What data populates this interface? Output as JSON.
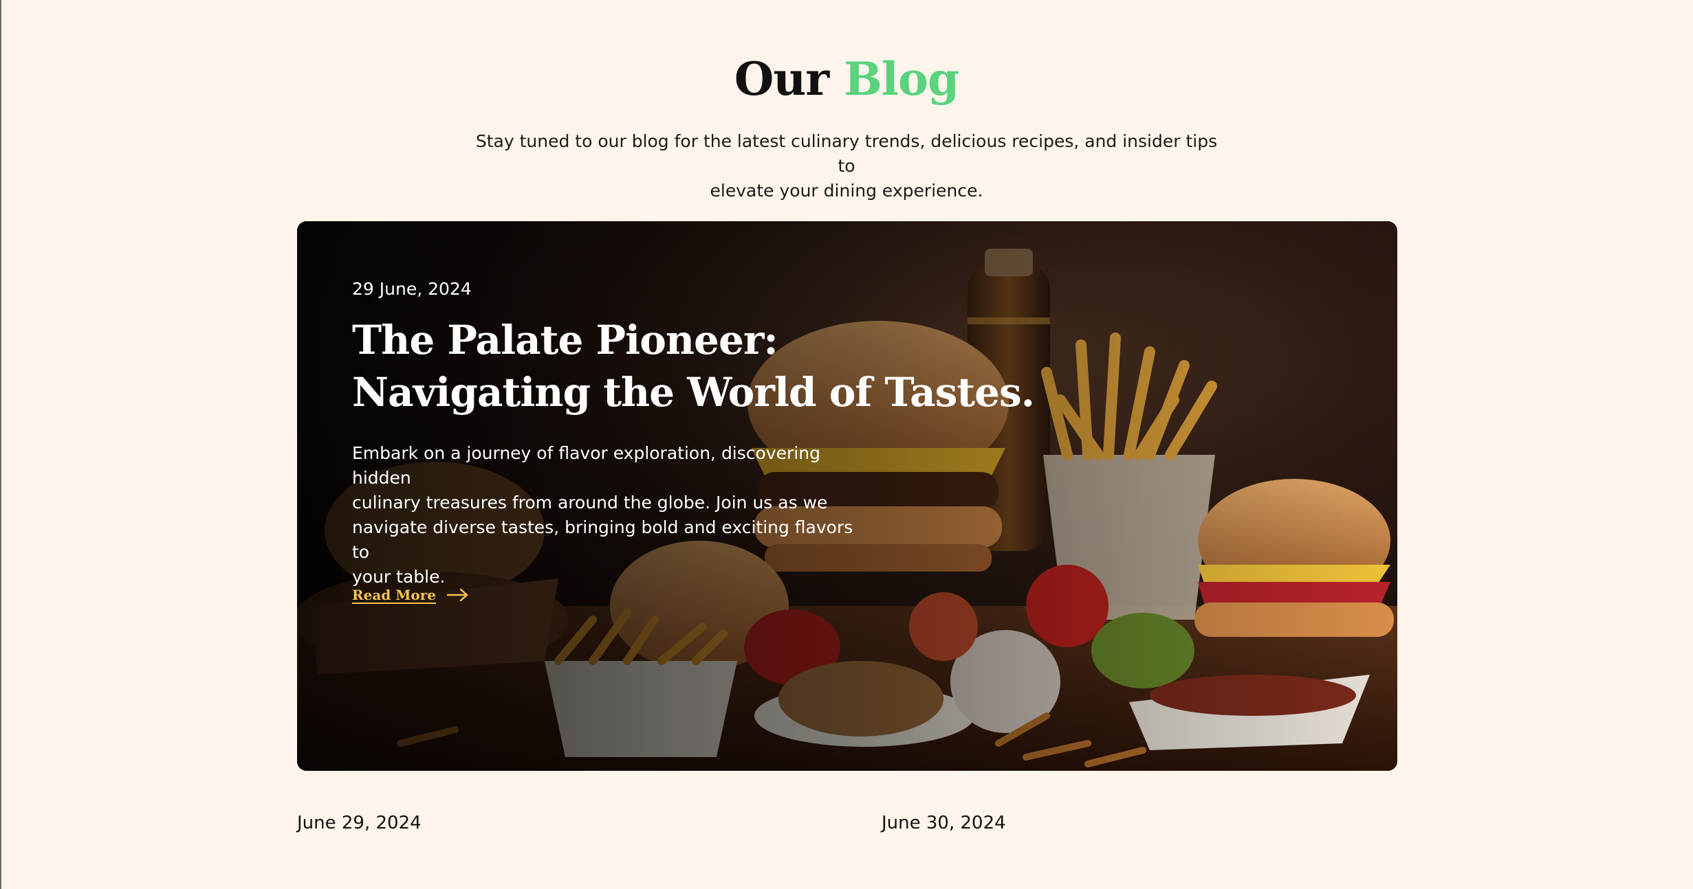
{
  "section": {
    "title_part1": "Our",
    "title_part2": "Blog",
    "subtitle_line1": "Stay tuned to our blog for the latest culinary trends, delicious recipes, and insider tips to",
    "subtitle_line2": "elevate your dining experience."
  },
  "featured_post": {
    "date": "29 June, 2024",
    "title_line1": "The Palate Pioneer:",
    "title_line2": "Navigating the World of Tastes.",
    "excerpt_lines": [
      "Embark on a journey of flavor exploration, discovering hidden",
      "culinary treasures from around the globe. Join us as we",
      "navigate diverse tastes, bringing bold and exciting flavors to",
      "your table."
    ],
    "read_more_label": "Read More",
    "read_more_icon": "arrow-right-icon",
    "image_description_icon": "food-spread-image"
  },
  "post_list": [
    {
      "date": "June 29, 2024"
    },
    {
      "date": "June 30, 2024"
    }
  ],
  "colors": {
    "background": "#fdf5eb",
    "accent_green": "#5ad27e",
    "read_more_yellow": "#f5c54c",
    "text": "#111111"
  }
}
